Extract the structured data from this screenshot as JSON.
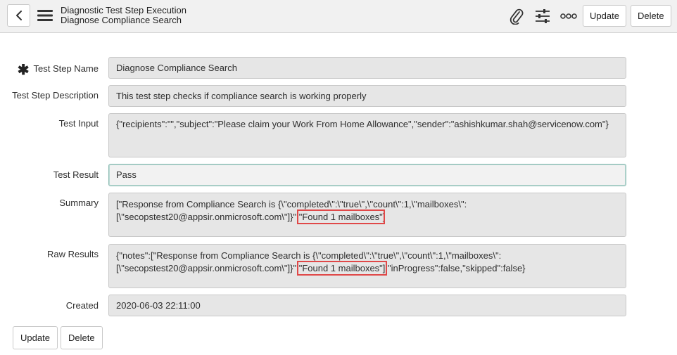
{
  "header": {
    "title": "Diagnostic Test Step Execution",
    "subtitle": "Diagnose Compliance Search",
    "update_label": "Update",
    "delete_label": "Delete",
    "icons": [
      "back-icon",
      "hamburger-menu-icon",
      "paperclip-icon",
      "sliders-icon",
      "more-options-icon"
    ]
  },
  "form": {
    "test_step_name": {
      "label": "Test Step Name",
      "value": "Diagnose Compliance Search",
      "mandatory": true
    },
    "test_step_description": {
      "label": "Test Step Description",
      "value": "This test step checks if compliance search is working properly"
    },
    "test_input": {
      "label": "Test Input",
      "value": "{\"recipients\":\"\",\"subject\":\"Please claim your Work From Home Allowance\",\"sender\":\"ashishkumar.shah@servicenow.com\"}"
    },
    "test_result": {
      "label": "Test Result",
      "value": "Pass"
    },
    "summary": {
      "label": "Summary",
      "line1": "[\"Response from Compliance Search is {\\\"completed\\\":\\\"true\\\",\\\"count\\\":1,\\\"mailboxes\\\":",
      "line2_pre": "[\\\"secopstest20@appsir.onmicrosoft.com\\\"]}\",",
      "line2_highlight": "\"Found 1 mailboxes\"",
      "line2_post": "]"
    },
    "raw_results": {
      "label": "Raw Results",
      "line1": "{\"notes\":[\"Response from Compliance Search is {\\\"completed\\\":\\\"true\\\",\\\"count\\\":1,\\\"mailboxes\\\":",
      "line2_pre": "[\\\"secopstest20@appsir.onmicrosoft.com\\\"]}\",",
      "line2_highlight": "\"Found 1 mailboxes\"]",
      "line2_post": ",\"inProgress\":false,\"skipped\":false}"
    },
    "created": {
      "label": "Created",
      "value": "2020-06-03 22:11:00"
    }
  },
  "footer": {
    "update_label": "Update",
    "delete_label": "Delete"
  },
  "colors": {
    "header_bg": "#f1f1f1",
    "field_bg": "#e6e6e6",
    "highlight_border": "#e04848",
    "active_border": "#8fbcb4"
  }
}
